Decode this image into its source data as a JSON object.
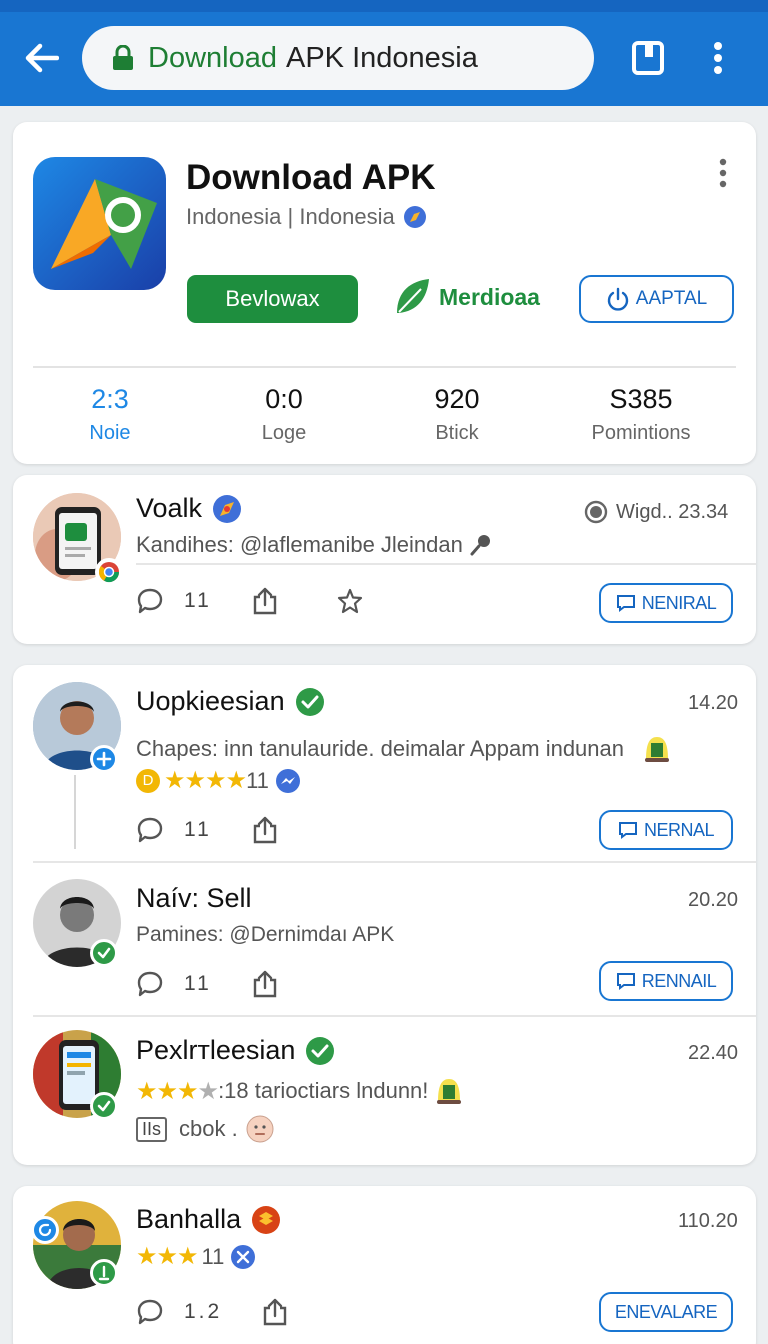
{
  "browser": {
    "url_host": "Download",
    "url_rest": "APK Indonesia"
  },
  "app": {
    "title": "Download APK",
    "subtitle": "Indonesia | Indonesia",
    "download_label": "Bevlowax",
    "middle_label": "Merdioaa",
    "outline_label": "AAPTAL",
    "stats": [
      {
        "value": "2:3",
        "label": "Noie"
      },
      {
        "value": "0:0",
        "label": "Loge"
      },
      {
        "value": "920",
        "label": "Btick"
      },
      {
        "value": "S385",
        "label": "Pomintions"
      }
    ]
  },
  "posts": [
    {
      "name": "Voalk",
      "meta": "Wigd.. 23.34",
      "text": "Kandihes: @laflemanibe Jleindan",
      "comments": "11",
      "button": "NENIRAL"
    },
    {
      "name": "Uopkieesian",
      "time": "14.20",
      "text": "Chapes: inn tanulauride. deimalar Appam indunan",
      "badge": "D",
      "rating_count": "11",
      "comments": "11",
      "button": "NERNAL"
    },
    {
      "name": "Naív: Sell",
      "time": "20.20",
      "text": "Pamines: @Dernimdaı APK",
      "comments": "11",
      "button": "RENNAIL"
    },
    {
      "name": "Pexlrтleesian",
      "time": "22.40",
      "text": ":18 tarioctiars lndunn!",
      "tag": "IIs",
      "tag_text": "cbok ."
    },
    {
      "name": "Banhalla",
      "time": "110.20",
      "rating_count": "11",
      "comments": "1.2",
      "button": "ENEVALARE"
    }
  ]
}
